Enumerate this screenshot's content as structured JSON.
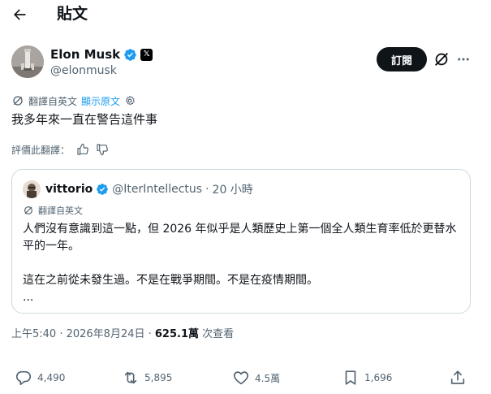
{
  "header": {
    "title": "貼文"
  },
  "author": {
    "name": "Elon Musk",
    "handle": "@elonmusk",
    "x_badge": "𝕏",
    "subscribe_label": "訂閱"
  },
  "post": {
    "translated_from": "翻譯自英文",
    "show_original": "顯示原文",
    "text": "我多年來一直在警告這件事",
    "rate_translation": "評價此翻譯："
  },
  "quote": {
    "name": "vittorio",
    "handle": "@IterIntellectus",
    "separator": "·",
    "time": "20 小時",
    "translated_label": "翻譯自英文",
    "paragraph1": "人們沒有意識到這一點，但 2026 年似乎是人類歷史上第一個全人類生育率低於更替水平的一年。",
    "paragraph2": "這在之前從未發生過。不是在戰爭期間。不是在疫情期間。",
    "ellipsis": "..."
  },
  "meta": {
    "time": "上午5:40 · 2026年8月24日 · ",
    "views": "625.1萬",
    "views_label": " 次查看"
  },
  "actions": {
    "replies": "4,490",
    "reposts": "5,895",
    "likes": "4.5萬",
    "bookmarks": "1,696"
  },
  "colors": {
    "verified": "#1d9bf0",
    "link": "#1d9bf0",
    "secondary_text": "#536471",
    "border": "#cfd9de",
    "subscribe_bg": "#0f1419"
  }
}
